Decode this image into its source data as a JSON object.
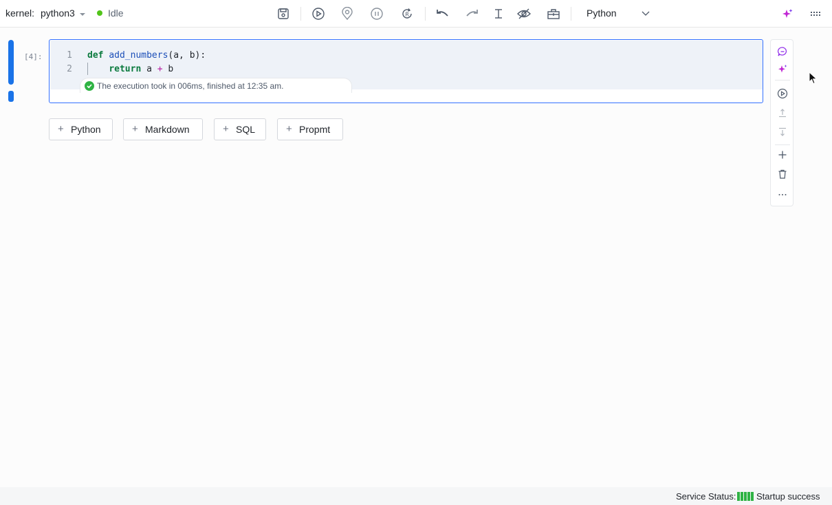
{
  "toolbar": {
    "kernel_label": "kernel:",
    "kernel_name": "python3",
    "status": "Idle",
    "status_color": "#52c41a",
    "language": "Python",
    "icons": [
      "save-icon",
      "run-icon",
      "location-icon",
      "pause-icon",
      "restart-icon",
      "undo-icon",
      "redo-icon",
      "text-cursor-icon",
      "hide-icon",
      "toolbox-icon",
      "ai-sparkle-icon",
      "grid-menu-icon"
    ]
  },
  "cell": {
    "execution_count": "[4]:",
    "lines": [
      {
        "number": "1",
        "text": "def add_numbers(a, b):"
      },
      {
        "number": "2",
        "text": "    return a + b"
      }
    ],
    "execution_message": "The execution took in 006ms, finished at 12:35 am.",
    "accent_color": "#3370ff"
  },
  "add_buttons": [
    {
      "label": "Python"
    },
    {
      "label": "Markdown"
    },
    {
      "label": "SQL"
    },
    {
      "label": "Propmt"
    }
  ],
  "cell_tools": [
    "chat-icon",
    "ai-sparkle-icon",
    "run-cell-icon",
    "move-up-icon",
    "move-down-icon",
    "add-cell-icon",
    "delete-icon",
    "more-icon"
  ],
  "footer": {
    "service_label": "Service Status:",
    "service_status": "Startup success",
    "status_color": "#2fb344"
  }
}
